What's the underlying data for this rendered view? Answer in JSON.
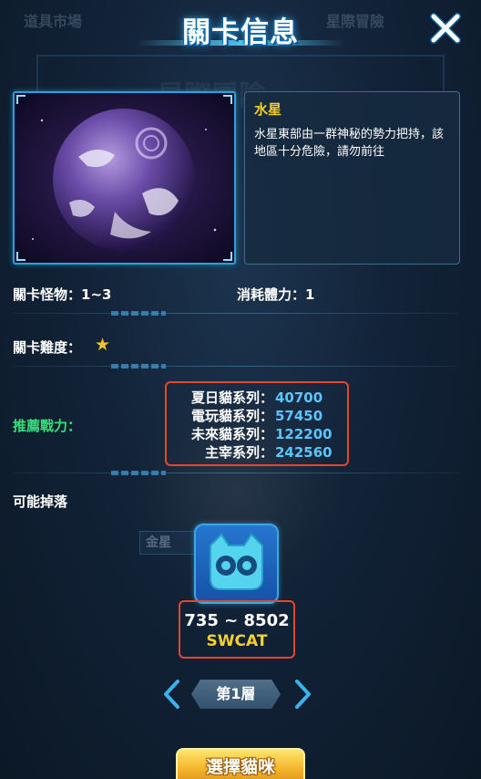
{
  "background": {
    "tabs": [
      "道具市場",
      "星際冒險"
    ],
    "watermark": "星際冒險",
    "plate": "金星"
  },
  "header": {
    "title": "關卡信息",
    "close_icon": "close-icon"
  },
  "stage": {
    "name": "水星",
    "description": "水星東部由一群神秘的勢力把持，該地區十分危險，請勿前往"
  },
  "stats": {
    "monsters": "關卡怪物：1~3",
    "stamina_cost": "消耗體力：1",
    "difficulty_label": "關卡難度：",
    "difficulty_stars": 1
  },
  "recommended": {
    "label": "推薦戰力：",
    "rows": [
      {
        "series": "夏日貓系列：",
        "power": "40700"
      },
      {
        "series": "電玩貓系列：",
        "power": "57450"
      },
      {
        "series": "未來貓系列：",
        "power": "122200"
      },
      {
        "series": "主宰系列：",
        "power": "242560"
      }
    ]
  },
  "drops": {
    "label": "可能掉落",
    "item_icon": "cat-mask-icon",
    "range": "735 ~ 8502",
    "token": "SWCAT"
  },
  "pager": {
    "floor": "第1層"
  },
  "actions": {
    "select_cat": "選擇貓咪"
  },
  "colors": {
    "accent_blue": "#27a3da",
    "highlight_red": "#e8452a",
    "gold": "#f6cf2d",
    "green": "#35e07a",
    "power_blue": "#5cc5ff"
  }
}
